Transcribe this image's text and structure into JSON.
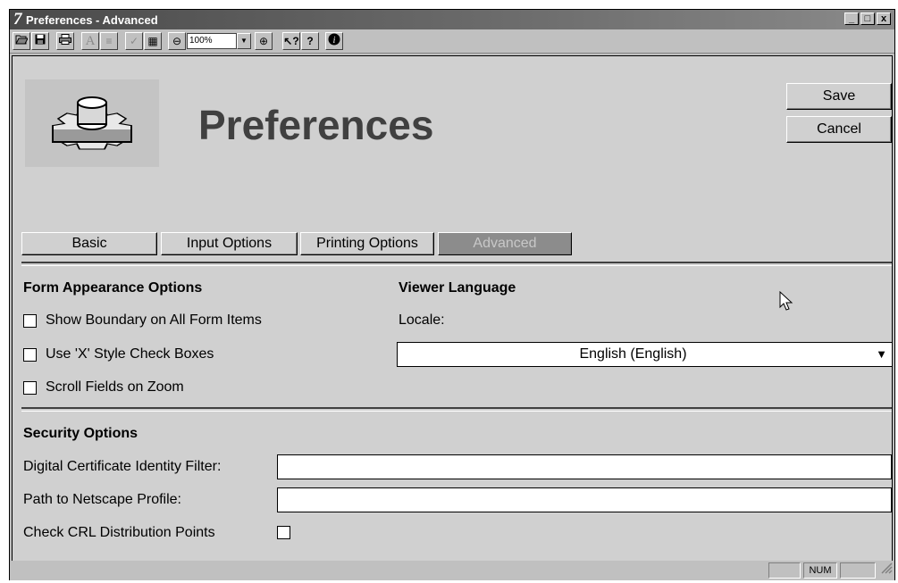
{
  "window": {
    "logo_glyph": "7",
    "title": "Preferences - Advanced",
    "buttons": [
      {
        "name": "minimize-button",
        "glyph": "_"
      },
      {
        "name": "maximize-button",
        "glyph": "□"
      },
      {
        "name": "close-button",
        "glyph": "x"
      }
    ]
  },
  "toolbar": {
    "zoom_value": "100%",
    "zoom_arrow": "▼",
    "zoom_out_glyph": "⊖",
    "zoom_in_glyph": "⊕",
    "buttons": [
      {
        "name": "open-icon",
        "glyph": "📂",
        "dim": false
      },
      {
        "name": "save-icon",
        "glyph": "💾",
        "dim": false
      },
      {
        "name": "print-icon",
        "glyph": "🖶",
        "dim": false
      },
      {
        "name": "font-icon",
        "glyph": "A",
        "dim": true
      },
      {
        "name": "justify-icon",
        "glyph": "≡",
        "dim": true
      },
      {
        "name": "spellcheck-icon",
        "glyph": "✓",
        "dim": true
      },
      {
        "name": "calculator-icon",
        "glyph": "▦",
        "dim": false
      },
      {
        "name": "whats-this-icon",
        "glyph": "?",
        "dim": false
      },
      {
        "name": "help-icon",
        "glyph": "?",
        "dim": false
      },
      {
        "name": "info-icon",
        "glyph": "i",
        "dim": false
      }
    ]
  },
  "header": {
    "title": "Preferences",
    "save_label": "Save",
    "cancel_label": "Cancel"
  },
  "tabs": [
    {
      "label": "Basic",
      "active": false
    },
    {
      "label": "Input Options",
      "active": false
    },
    {
      "label": "Printing Options",
      "active": false
    },
    {
      "label": "Advanced",
      "active": true
    }
  ],
  "form_appearance": {
    "heading": "Form Appearance Options",
    "options": [
      {
        "label": "Show Boundary on All Form Items",
        "checked": false
      },
      {
        "label": "Use 'X' Style Check Boxes",
        "checked": false
      },
      {
        "label": "Scroll Fields on Zoom",
        "checked": false
      }
    ]
  },
  "viewer_language": {
    "heading": "Viewer Language",
    "locale_label": "Locale:",
    "locale_value": "English (English)",
    "dropdown_arrow": "▼"
  },
  "security": {
    "heading": "Security Options",
    "cert_filter_label": "Digital Certificate Identity Filter:",
    "cert_filter_value": "",
    "netscape_label": "Path to Netscape Profile:",
    "netscape_value": "",
    "crl_label": "Check CRL Distribution Points",
    "crl_checked": false
  },
  "statusbar": {
    "num_label": "NUM"
  }
}
